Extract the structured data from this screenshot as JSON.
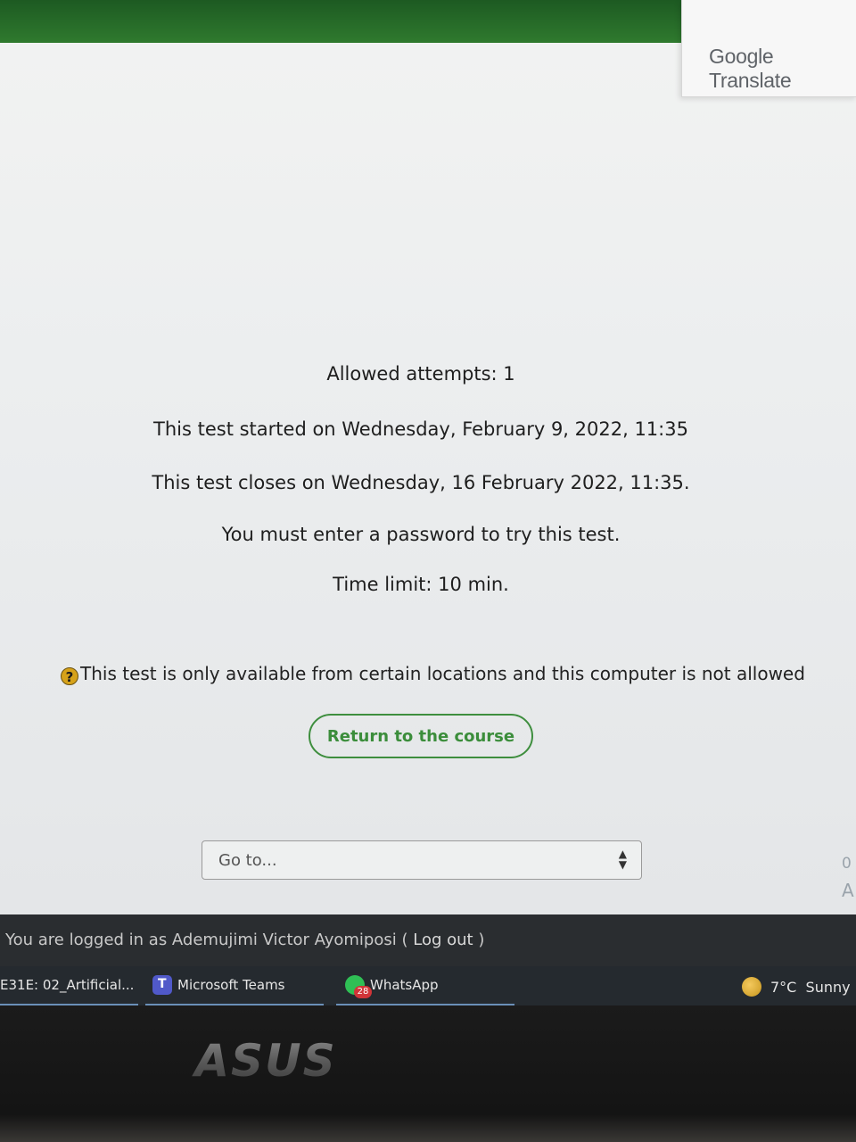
{
  "translate_panel": {
    "title": "Google Translate"
  },
  "quiz_info": {
    "attempts": "Allowed attempts: 1",
    "started": "This test started on Wednesday, February 9, 2022, 11:35",
    "closes": "This test closes on Wednesday, 16 February 2022, 11:35.",
    "password": "You must enter a password to try this test.",
    "time_limit": "Time limit: 10 min."
  },
  "warning": {
    "icon": "help-icon",
    "text": "This test is only available from certain locations and this computer is not allowed"
  },
  "return_button": {
    "label": "Return to the course"
  },
  "goto": {
    "selected": "Go to..."
  },
  "edge": {
    "text1": "0",
    "text2": "A"
  },
  "footer": {
    "logged_in": "You are logged in as Ademujimi Victor Ayomiposi",
    "logout": "Log out"
  },
  "taskbar": {
    "items": [
      {
        "label": "E31E: 02_Artificial...",
        "icon": "browser-tab-icon"
      },
      {
        "label": "Microsoft Teams",
        "icon": "teams-icon"
      },
      {
        "label": "WhatsApp",
        "icon": "whatsapp-icon",
        "badge": "28"
      }
    ],
    "weather": {
      "temp": "7°C",
      "condition": "Sunny",
      "icon": "sun-icon"
    }
  },
  "laptop": {
    "brand": "ASUS"
  },
  "colors": {
    "accent_green": "#3e8e3e",
    "topbar_green": "#2f7a2e",
    "help_icon": "#d6a21a"
  }
}
